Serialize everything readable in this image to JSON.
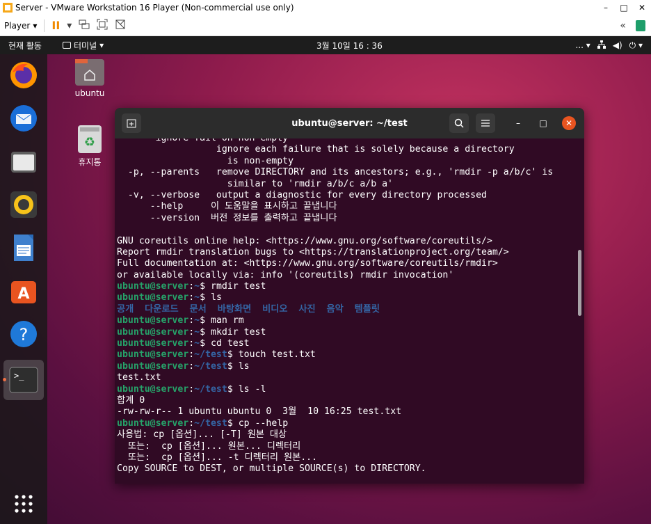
{
  "vm_window": {
    "title": "Server - VMware Workstation 16 Player (Non-commercial use only)",
    "controls": [
      "–",
      "□",
      "✕"
    ]
  },
  "vm_toolbar": {
    "player_label": "Player",
    "dropdown_arrow": "▾",
    "pause_glyph": "II",
    "icons": [
      "send-ctrl-alt-del-icon",
      "fit-guest-icon",
      "unity-icon"
    ],
    "right_icons": [
      "«",
      "note-icon"
    ]
  },
  "topbar": {
    "activities": "현재 활동",
    "app_menu": "터미널",
    "clock": "3월 10일  16 : 36",
    "tray_more": "... ▾"
  },
  "dock": {
    "items": [
      "firefox",
      "thunderbird",
      "files",
      "rhythmbox",
      "libreoffice-writer",
      "software",
      "help",
      "terminal"
    ],
    "apps_grid": "show-applications"
  },
  "desktop_icons": [
    {
      "label": "ubuntu"
    },
    {
      "label": "휴지통"
    }
  ],
  "terminal": {
    "title": "ubuntu@server: ~/test",
    "lines": [
      {
        "parts": [
          {
            "t": "       ignore-fail-on-non-empty",
            "c": ""
          }
        ]
      },
      {
        "parts": [
          {
            "t": "                  ignore each failure that is solely because a directory",
            "c": ""
          }
        ]
      },
      {
        "parts": [
          {
            "t": "                    is non-empty",
            "c": ""
          }
        ]
      },
      {
        "parts": [
          {
            "t": "  -p, --parents   remove DIRECTORY and its ancestors; e.g., 'rmdir -p a/b/c' is",
            "c": ""
          }
        ]
      },
      {
        "parts": [
          {
            "t": "                    similar to 'rmdir a/b/c a/b a'",
            "c": ""
          }
        ]
      },
      {
        "parts": [
          {
            "t": "  -v, --verbose   output a diagnostic for every directory processed",
            "c": ""
          }
        ]
      },
      {
        "parts": [
          {
            "t": "      --help     이 도움말을 표시하고 끝냅니다",
            "c": ""
          }
        ]
      },
      {
        "parts": [
          {
            "t": "      --version  버전 정보를 출력하고 끝냅니다",
            "c": ""
          }
        ]
      },
      {
        "parts": [
          {
            "t": "",
            "c": ""
          }
        ]
      },
      {
        "parts": [
          {
            "t": "GNU coreutils online help: <https://www.gnu.org/software/coreutils/>",
            "c": ""
          }
        ]
      },
      {
        "parts": [
          {
            "t": "Report rmdir translation bugs to <https://translationproject.org/team/>",
            "c": ""
          }
        ]
      },
      {
        "parts": [
          {
            "t": "Full documentation at: <https://www.gnu.org/software/coreutils/rmdir>",
            "c": ""
          }
        ]
      },
      {
        "parts": [
          {
            "t": "or available locally via: info '(coreutils) rmdir invocation'",
            "c": ""
          }
        ]
      },
      {
        "parts": [
          {
            "t": "ubuntu@server",
            "c": "user"
          },
          {
            "t": ":",
            "c": ""
          },
          {
            "t": "~",
            "c": "path"
          },
          {
            "t": "$ rmdir test",
            "c": ""
          }
        ]
      },
      {
        "parts": [
          {
            "t": "ubuntu@server",
            "c": "user"
          },
          {
            "t": ":",
            "c": ""
          },
          {
            "t": "~",
            "c": "path"
          },
          {
            "t": "$ ls",
            "c": ""
          }
        ]
      },
      {
        "parts": [
          {
            "t": "공개  다운로드  문서  바탕화면  비디오  사진  음악  템플릿",
            "c": "dirs"
          }
        ]
      },
      {
        "parts": [
          {
            "t": "ubuntu@server",
            "c": "user"
          },
          {
            "t": ":",
            "c": ""
          },
          {
            "t": "~",
            "c": "path"
          },
          {
            "t": "$ man rm",
            "c": ""
          }
        ]
      },
      {
        "parts": [
          {
            "t": "ubuntu@server",
            "c": "user"
          },
          {
            "t": ":",
            "c": ""
          },
          {
            "t": "~",
            "c": "path"
          },
          {
            "t": "$ mkdir test",
            "c": ""
          }
        ]
      },
      {
        "parts": [
          {
            "t": "ubuntu@server",
            "c": "user"
          },
          {
            "t": ":",
            "c": ""
          },
          {
            "t": "~",
            "c": "path"
          },
          {
            "t": "$ cd test",
            "c": ""
          }
        ]
      },
      {
        "parts": [
          {
            "t": "ubuntu@server",
            "c": "user"
          },
          {
            "t": ":",
            "c": ""
          },
          {
            "t": "~/test",
            "c": "path"
          },
          {
            "t": "$ touch test.txt",
            "c": ""
          }
        ]
      },
      {
        "parts": [
          {
            "t": "ubuntu@server",
            "c": "user"
          },
          {
            "t": ":",
            "c": ""
          },
          {
            "t": "~/test",
            "c": "path"
          },
          {
            "t": "$ ls",
            "c": ""
          }
        ]
      },
      {
        "parts": [
          {
            "t": "test.txt",
            "c": ""
          }
        ]
      },
      {
        "parts": [
          {
            "t": "ubuntu@server",
            "c": "user"
          },
          {
            "t": ":",
            "c": ""
          },
          {
            "t": "~/test",
            "c": "path"
          },
          {
            "t": "$ ls -l",
            "c": ""
          }
        ]
      },
      {
        "parts": [
          {
            "t": "합계 0",
            "c": ""
          }
        ]
      },
      {
        "parts": [
          {
            "t": "-rw-rw-r-- 1 ubuntu ubuntu 0  3월  10 16:25 test.txt",
            "c": ""
          }
        ]
      },
      {
        "parts": [
          {
            "t": "ubuntu@server",
            "c": "user"
          },
          {
            "t": ":",
            "c": ""
          },
          {
            "t": "~/test",
            "c": "path"
          },
          {
            "t": "$ cp --help",
            "c": ""
          }
        ]
      },
      {
        "parts": [
          {
            "t": "사용법: cp [옵션]... [-T] 원본 대상",
            "c": ""
          }
        ]
      },
      {
        "parts": [
          {
            "t": "  또는:  cp [옵션]... 원본... 디렉터리",
            "c": ""
          }
        ]
      },
      {
        "parts": [
          {
            "t": "  또는:  cp [옵션]... -t 디렉터리 원본...",
            "c": ""
          }
        ]
      },
      {
        "parts": [
          {
            "t": "Copy SOURCE to DEST, or multiple SOURCE(s) to DIRECTORY.",
            "c": ""
          }
        ]
      }
    ]
  },
  "colors": {
    "terminal_bg": "#300a24",
    "prompt_user": "#26a269",
    "prompt_path": "#3465a4",
    "accent": "#e95420"
  }
}
